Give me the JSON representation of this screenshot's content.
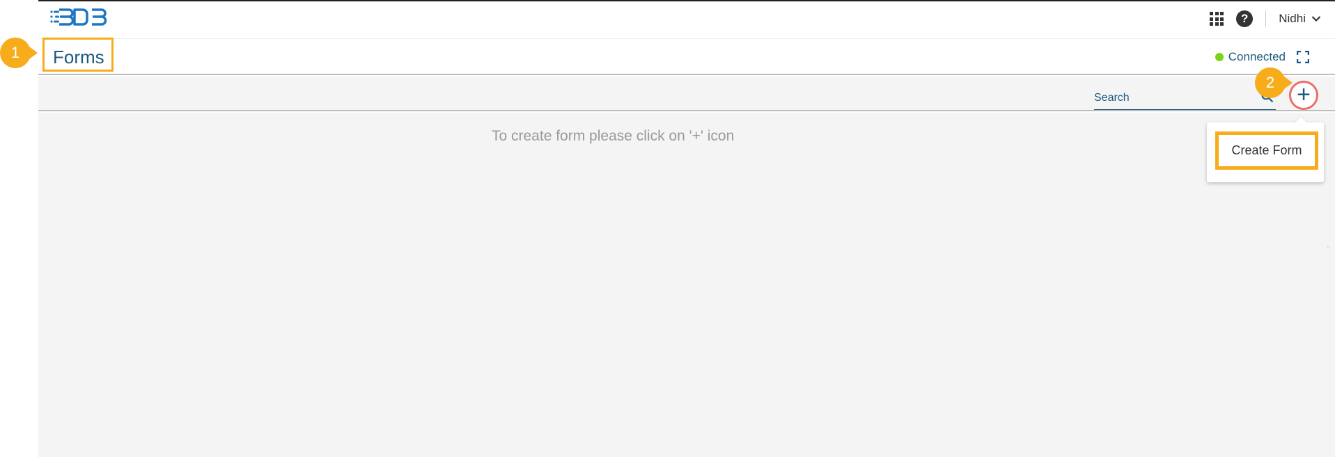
{
  "header": {
    "logo_label": "BDB",
    "user_name": "Nidhi",
    "colors": {
      "brand": "#1b5a7e",
      "logo": "#1c76c4"
    }
  },
  "page": {
    "title": "Forms",
    "status_text": "Connected",
    "status_color": "#7cd31a"
  },
  "toolbar": {
    "search_placeholder": "Search",
    "add_label": "+"
  },
  "dropdown": {
    "items": [
      {
        "label": "Create Form"
      }
    ]
  },
  "main": {
    "empty_message": "To create form please click on '+' icon"
  },
  "annotations": {
    "callouts": [
      "1",
      "2"
    ],
    "highlight_color": "#f7ac1c",
    "ring_color": "#e8706b"
  },
  "icons": [
    "bdb-logo",
    "apps-grid-icon",
    "help-icon",
    "chevron-down-icon",
    "status-dot",
    "fullscreen-icon",
    "search-icon",
    "plus-icon"
  ]
}
